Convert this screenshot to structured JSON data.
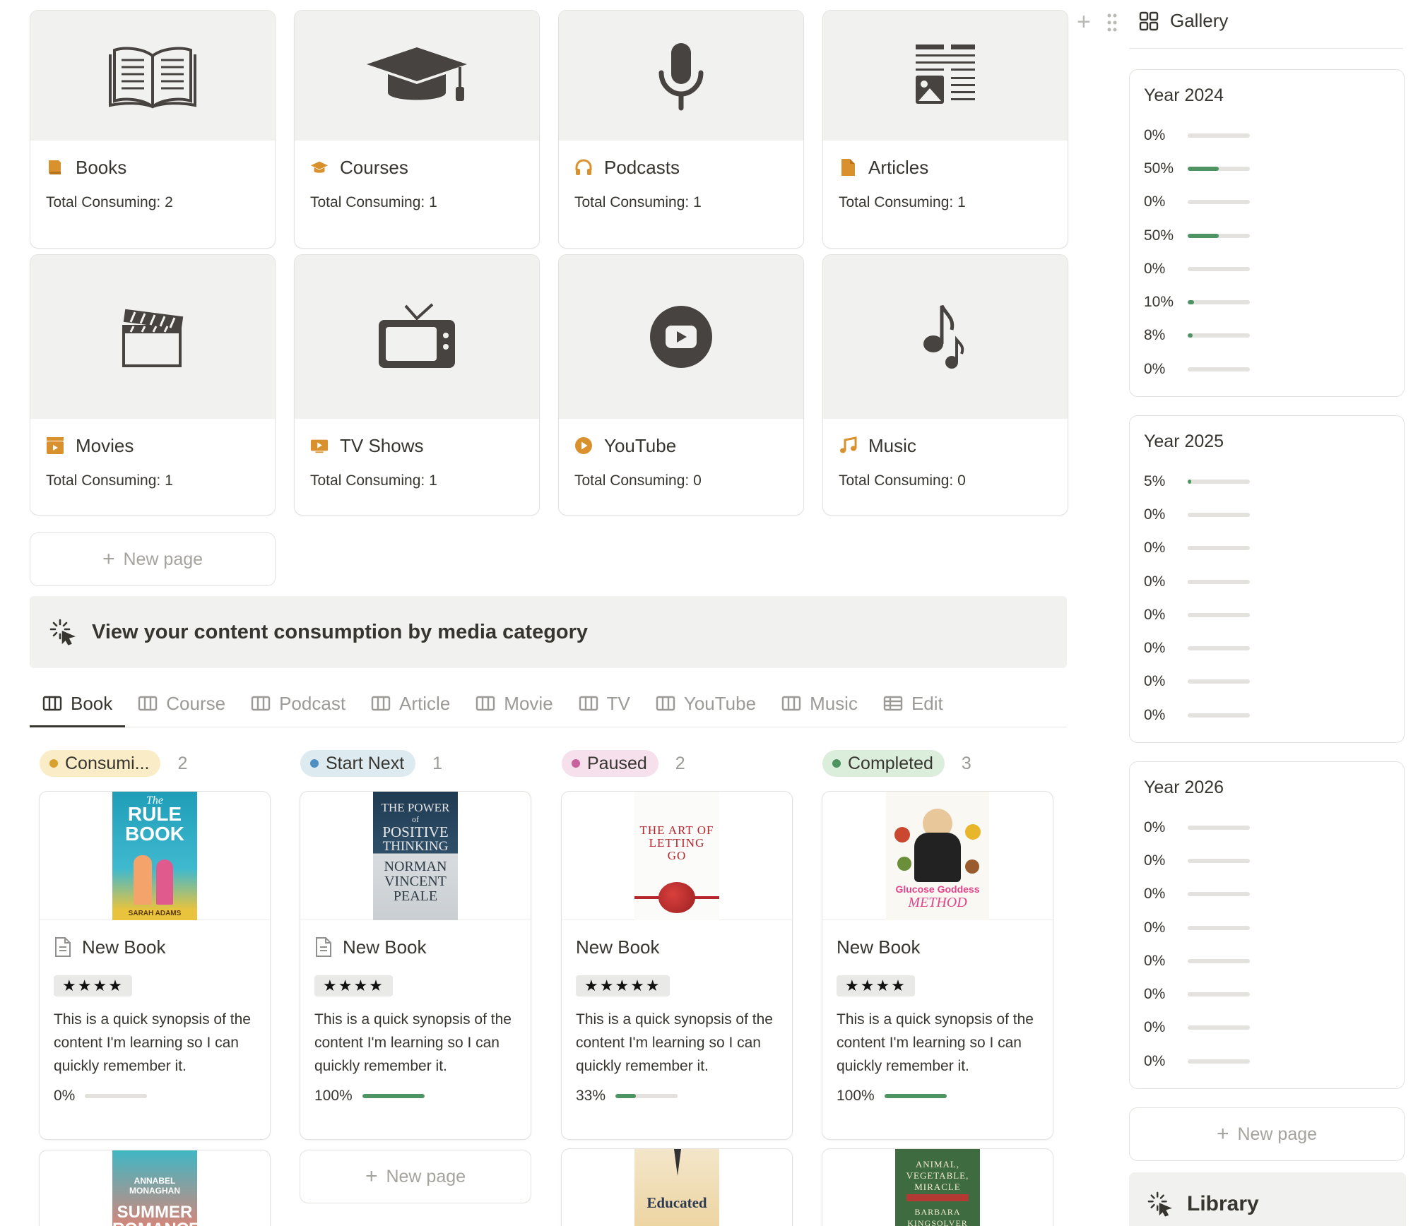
{
  "categories": [
    {
      "name": "Books",
      "count_text": "Total Consuming: 2",
      "icon": "book-icon"
    },
    {
      "name": "Courses",
      "count_text": "Total Consuming: 1",
      "icon": "graduation-cap-icon"
    },
    {
      "name": "Podcasts",
      "count_text": "Total Consuming: 1",
      "icon": "headphones-icon"
    },
    {
      "name": "Articles",
      "count_text": "Total Consuming: 1",
      "icon": "document-icon"
    },
    {
      "name": "Movies",
      "count_text": "Total Consuming: 1",
      "icon": "clapperboard-icon"
    },
    {
      "name": "TV Shows",
      "count_text": "Total Consuming: 1",
      "icon": "tv-icon"
    },
    {
      "name": "YouTube",
      "count_text": "Total Consuming: 0",
      "icon": "play-icon"
    },
    {
      "name": "Music",
      "count_text": "Total Consuming: 0",
      "icon": "music-note-icon"
    }
  ],
  "new_page_label": "New page",
  "callout": {
    "text": "View your content consumption by media category"
  },
  "tabs": [
    {
      "label": "Book",
      "active": true
    },
    {
      "label": "Course"
    },
    {
      "label": "Podcast"
    },
    {
      "label": "Article"
    },
    {
      "label": "Movie"
    },
    {
      "label": "TV"
    },
    {
      "label": "YouTube"
    },
    {
      "label": "Music"
    },
    {
      "label": "Edit"
    }
  ],
  "board": {
    "columns": [
      {
        "status": "Consumi...",
        "count": "2",
        "pill_bg": "#fbecc8",
        "dot": "#d9a02e"
      },
      {
        "status": "Start Next",
        "count": "1",
        "pill_bg": "#ddebf1",
        "dot": "#4d8fc4"
      },
      {
        "status": "Paused",
        "count": "2",
        "pill_bg": "#f5e0ec",
        "dot": "#c7609b"
      },
      {
        "status": "Completed",
        "count": "3",
        "pill_bg": "#dbeddb",
        "dot": "#4d9462"
      }
    ],
    "cards": [
      {
        "title": "New Book",
        "stars": "★★★★",
        "synopsis": "This is a quick synopsis of the content I'm learning so I can quickly remember it.",
        "progress_text": "0%",
        "progress": 0,
        "cover": {
          "top": "The",
          "line1": "RULE",
          "line2": "BOOK",
          "author": "SARAH ADAMS"
        }
      },
      {
        "title": "New Book",
        "stars": "★★★★",
        "synopsis": "This is a quick synopsis of the content I'm learning so I can quickly remember it.",
        "progress_text": "100%",
        "progress": 1,
        "cover": {
          "line1": "THE POWER",
          "line2": "of",
          "line3": "POSITIVE",
          "line4": "THINKING",
          "author1": "NORMAN",
          "author2": "VINCENT",
          "author3": "PEALE"
        }
      },
      {
        "title": "New Book",
        "stars": "★★★★★",
        "synopsis": "This is a quick synopsis of the content I'm learning so I can quickly remember it.",
        "progress_text": "33%",
        "progress": 0.33,
        "cover": {
          "line1": "THE ART OF",
          "line2": "LETTING",
          "line3": "GO"
        }
      },
      {
        "title": "New Book",
        "stars": "★★★★",
        "synopsis": "This is a quick synopsis of the content I'm learning so I can quickly remember it.",
        "progress_text": "100%",
        "progress": 1,
        "cover": {
          "line1": "Glucose Goddess",
          "line2": "METHOD"
        }
      }
    ],
    "second_row": [
      {
        "cover": {
          "line1": "ANNABEL",
          "line2": "MONAGHAN",
          "line3": "SUMMER",
          "line4": "ROMANCE"
        }
      },
      {
        "cover": {
          "line1": "Educated"
        }
      },
      {
        "cover": {
          "line1": "ANIMAL,",
          "line2": "VEGETABLE,",
          "line3": "MIRACLE",
          "line4": "BARBARA",
          "line5": "KINGSOLVER"
        }
      }
    ]
  },
  "right_panel": {
    "header": "Gallery",
    "years": [
      {
        "title": "Year 2024",
        "rows": [
          {
            "label": "0%",
            "value": 0
          },
          {
            "label": "50%",
            "value": 0.5
          },
          {
            "label": "0%",
            "value": 0
          },
          {
            "label": "50%",
            "value": 0.5
          },
          {
            "label": "0%",
            "value": 0
          },
          {
            "label": "10%",
            "value": 0.1
          },
          {
            "label": "8%",
            "value": 0.08
          },
          {
            "label": "0%",
            "value": 0
          }
        ]
      },
      {
        "title": "Year 2025",
        "rows": [
          {
            "label": "5%",
            "value": 0.05
          },
          {
            "label": "0%",
            "value": 0
          },
          {
            "label": "0%",
            "value": 0
          },
          {
            "label": "0%",
            "value": 0
          },
          {
            "label": "0%",
            "value": 0
          },
          {
            "label": "0%",
            "value": 0
          },
          {
            "label": "0%",
            "value": 0
          },
          {
            "label": "0%",
            "value": 0
          }
        ]
      },
      {
        "title": "Year 2026",
        "rows": [
          {
            "label": "0%",
            "value": 0
          },
          {
            "label": "0%",
            "value": 0
          },
          {
            "label": "0%",
            "value": 0
          },
          {
            "label": "0%",
            "value": 0
          },
          {
            "label": "0%",
            "value": 0
          },
          {
            "label": "0%",
            "value": 0
          },
          {
            "label": "0%",
            "value": 0
          },
          {
            "label": "0%",
            "value": 0
          }
        ]
      }
    ],
    "library_label": "Library"
  },
  "colors": {
    "accent_orange": "#d9912d",
    "progress_green": "#4d9462",
    "icon_dark": "#474340"
  }
}
